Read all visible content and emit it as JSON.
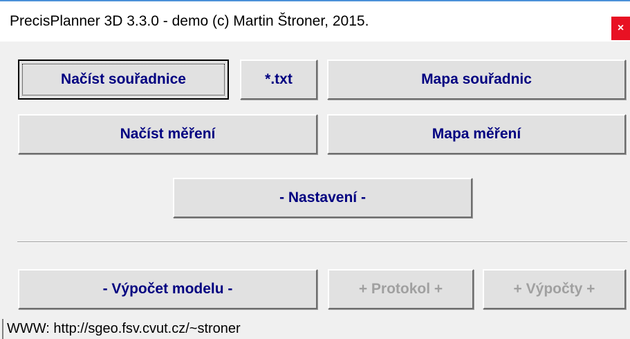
{
  "window": {
    "title": "PrecisPlanner 3D 3.3.0 - demo (c) Martin Štroner, 2015.",
    "close_glyph": "×"
  },
  "buttons": {
    "load_coords": "Načíst souřadnice",
    "txt": "*.txt",
    "coords_map": "Mapa souřadnic",
    "load_measurements": "Načíst měření",
    "measurements_map": "Mapa měření",
    "settings": "- Nastavení -",
    "compute_model": "- Výpočet modelu -",
    "protocol": "+ Protokol +",
    "calculations": "+ Výpočty +"
  },
  "status": {
    "text": "WWW: http://sgeo.fsv.cvut.cz/~stroner"
  },
  "colors": {
    "label": "#000080",
    "disabled_label": "#a0a0a0",
    "close": "#e81123"
  }
}
